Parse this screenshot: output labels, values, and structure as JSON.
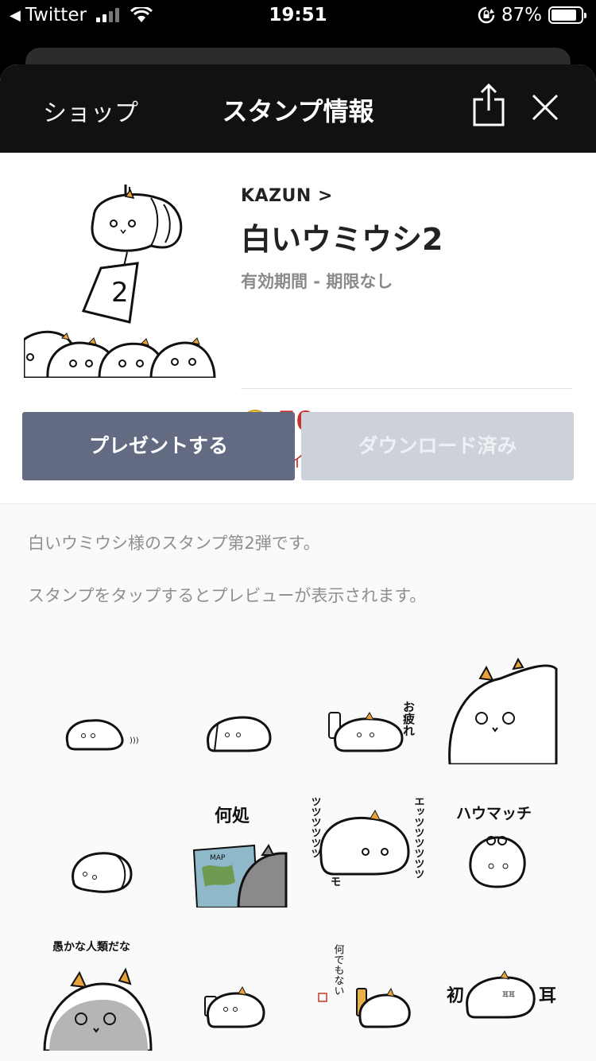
{
  "status_bar": {
    "back_app": "Twitter",
    "time": "19:51",
    "battery": "87%",
    "battery_level": 0.87
  },
  "nav": {
    "back_label": "ショップ",
    "title": "スタンプ情報"
  },
  "product": {
    "author": "KAZUN >",
    "title": "白いウミウシ2",
    "validity": "有効期間 - 期限なし",
    "coin_symbol": "L",
    "price": "50",
    "balance": "保有コイン: 41",
    "main_tag_number": "2"
  },
  "buttons": {
    "present": "プレゼントする",
    "download": "ダウンロード済み"
  },
  "description": {
    "text": "白いウミウシ様のスタンプ第2弾です。",
    "hint": "スタンプをタップするとプレビューが表示されます。"
  },
  "stickers": [
    {
      "caption": ""
    },
    {
      "caption": ""
    },
    {
      "caption": "お疲れ"
    },
    {
      "caption": ""
    },
    {
      "caption": ""
    },
    {
      "caption": "何処",
      "map_text": "MAP"
    },
    {
      "caption_left": "ツツツツツツ",
      "caption_right": "エッツツツツツツ",
      "caption_bottom": "モ"
    },
    {
      "caption": "ハウマッチ"
    },
    {
      "caption": "愚かな人類だな"
    },
    {
      "caption": ""
    },
    {
      "caption": "何でもない"
    },
    {
      "caption_left": "初",
      "caption_right": "耳",
      "small": "耳耳"
    }
  ],
  "colors": {
    "nav_bg": "#111111",
    "present_button": "#636b83",
    "download_button_disabled": "#cdd1d9",
    "price_red": "#c9302c",
    "coin_gold": "#e9b92e"
  }
}
